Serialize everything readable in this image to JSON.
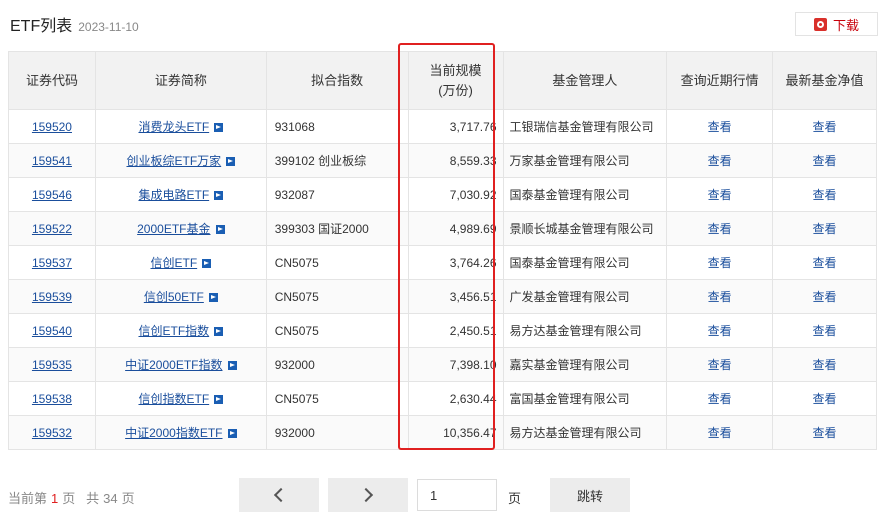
{
  "header": {
    "title": "ETF列表",
    "date": "2023-11-10",
    "download_label": "下载"
  },
  "table": {
    "columns": [
      "证券代码",
      "证券简称",
      "拟合指数",
      "当前规模",
      "(万份)",
      "基金管理人",
      "查询近期行情",
      "最新基金净值"
    ],
    "rows": [
      {
        "code": "159520",
        "name": "消费龙头ETF",
        "index": "931068",
        "size": "3,717.76",
        "manager": "工银瑞信基金管理有限公司",
        "quote": "查看",
        "nav": "查看"
      },
      {
        "code": "159541",
        "name": "创业板综ETF万家",
        "index": "399102 创业板综",
        "size": "8,559.33",
        "manager": "万家基金管理有限公司",
        "quote": "查看",
        "nav": "查看"
      },
      {
        "code": "159546",
        "name": "集成电路ETF",
        "index": "932087",
        "size": "7,030.92",
        "manager": "国泰基金管理有限公司",
        "quote": "查看",
        "nav": "查看"
      },
      {
        "code": "159522",
        "name": "2000ETF基金",
        "index": "399303 国证2000",
        "size": "4,989.69",
        "manager": "景顺长城基金管理有限公司",
        "quote": "查看",
        "nav": "查看"
      },
      {
        "code": "159537",
        "name": "信创ETF",
        "index": "CN5075",
        "size": "3,764.26",
        "manager": "国泰基金管理有限公司",
        "quote": "查看",
        "nav": "查看"
      },
      {
        "code": "159539",
        "name": "信创50ETF",
        "index": "CN5075",
        "size": "3,456.51",
        "manager": "广发基金管理有限公司",
        "quote": "查看",
        "nav": "查看"
      },
      {
        "code": "159540",
        "name": "信创ETF指数",
        "index": "CN5075",
        "size": "2,450.51",
        "manager": "易方达基金管理有限公司",
        "quote": "查看",
        "nav": "查看"
      },
      {
        "code": "159535",
        "name": "中证2000ETF指数",
        "index": "932000",
        "size": "7,398.10",
        "manager": "嘉实基金管理有限公司",
        "quote": "查看",
        "nav": "查看"
      },
      {
        "code": "159538",
        "name": "信创指数ETF",
        "index": "CN5075",
        "size": "2,630.44",
        "manager": "富国基金管理有限公司",
        "quote": "查看",
        "nav": "查看"
      },
      {
        "code": "159532",
        "name": "中证2000指数ETF",
        "index": "932000",
        "size": "10,356.47",
        "manager": "易方达基金管理有限公司",
        "quote": "查看",
        "nav": "查看"
      }
    ]
  },
  "pager": {
    "current_prefix": "当前第",
    "current_page": "1",
    "page_suffix": "页",
    "total_prefix": "共",
    "total_pages": "34",
    "total_suffix": "页",
    "input_value": "1",
    "unit_label": "页",
    "jump_label": "跳转"
  },
  "colors": {
    "highlight": "#e02020",
    "link": "#1a4e9c",
    "header_bg": "#f2f2f2"
  }
}
